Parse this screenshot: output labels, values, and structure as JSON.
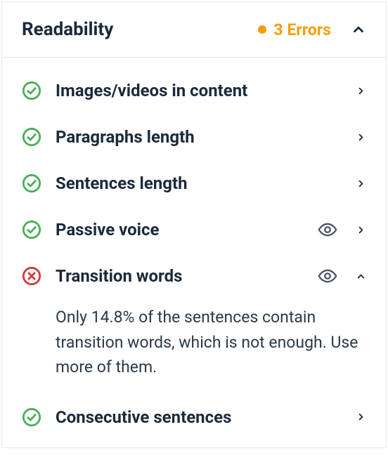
{
  "header": {
    "title": "Readability",
    "errors_label": "3 Errors"
  },
  "items": [
    {
      "label": "Images/videos in content",
      "status": "ok",
      "has_eye": false,
      "expanded": false,
      "detail": null
    },
    {
      "label": "Paragraphs length",
      "status": "ok",
      "has_eye": false,
      "expanded": false,
      "detail": null
    },
    {
      "label": "Sentences length",
      "status": "ok",
      "has_eye": false,
      "expanded": false,
      "detail": null
    },
    {
      "label": "Passive voice",
      "status": "ok",
      "has_eye": true,
      "expanded": false,
      "detail": null
    },
    {
      "label": "Transition words",
      "status": "error",
      "has_eye": true,
      "expanded": true,
      "detail": "Only 14.8% of the sentences contain transition words, which is not enough. Use more of them."
    },
    {
      "label": "Consecutive sentences",
      "status": "ok",
      "has_eye": false,
      "expanded": false,
      "detail": null
    }
  ],
  "colors": {
    "ok": "#4aae5b",
    "error": "#d33a3a",
    "badge": "#f59e0b",
    "text": "#1a2a3a",
    "chevron": "#1a2a3a",
    "eye": "#4a5568"
  }
}
